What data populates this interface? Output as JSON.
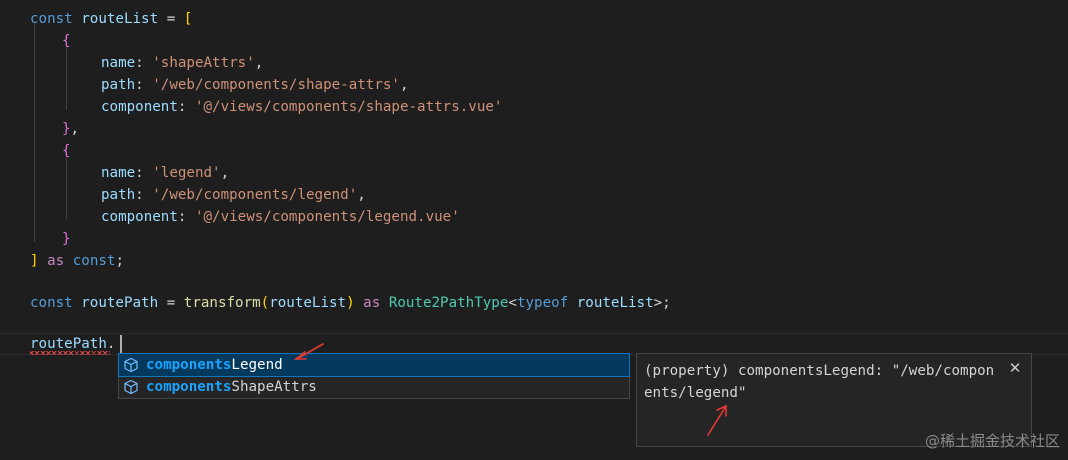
{
  "editor": {
    "lines": {
      "l1": {
        "kw": "const",
        "name": "routeList",
        "eq": "=",
        "open": "["
      },
      "l2": {
        "brace": "{"
      },
      "l3": {
        "key": "name",
        "colon": ":",
        "value": "'shapeAttrs'",
        "comma": ","
      },
      "l4": {
        "key": "path",
        "colon": ":",
        "value": "'/web/components/shape-attrs'",
        "comma": ","
      },
      "l5": {
        "key": "component",
        "colon": ":",
        "value": "'@/views/components/shape-attrs.vue'"
      },
      "l6": {
        "brace": "}",
        "comma": ","
      },
      "l7": {
        "brace": "{"
      },
      "l8": {
        "key": "name",
        "colon": ":",
        "value": "'legend'",
        "comma": ","
      },
      "l9": {
        "key": "path",
        "colon": ":",
        "value": "'/web/components/legend'",
        "comma": ","
      },
      "l10": {
        "key": "component",
        "colon": ":",
        "value": "'@/views/components/legend.vue'"
      },
      "l11": {
        "brace": "}"
      },
      "l12": {
        "close": "]",
        "as": "as",
        "const": "const",
        "semi": ";"
      },
      "l14": {
        "kw": "const",
        "name": "routePath",
        "eq": "=",
        "fn": "transform",
        "paren_open": "(",
        "arg": "routeList",
        "paren_close": ")",
        "as": "as",
        "type": "Route2PathType",
        "lt": "<",
        "typeof": "typeof",
        "typearg": "routeList",
        "gt": ">",
        "semi": ";"
      },
      "l16": {
        "name": "routePath",
        "dot": "."
      }
    }
  },
  "suggest": {
    "items": [
      {
        "match": "components",
        "rest": "Legend",
        "icon": "cube-icon",
        "selected": true
      },
      {
        "match": "components",
        "rest": "ShapeAttrs",
        "icon": "cube-icon",
        "selected": false
      }
    ]
  },
  "details": {
    "text": "(property) componentsLegend: \"/web/components/legend\"",
    "close_label": "✕"
  },
  "watermark": "@稀土掘金技术社区",
  "colors": {
    "background": "#1e1e1e",
    "keyword": "#569cd6",
    "control_keyword": "#c586c0",
    "variable": "#9cdcfe",
    "string": "#ce9178",
    "function": "#dcdcaa",
    "type": "#4ec9b0",
    "selection": "#04395e",
    "match": "#18a3ff",
    "annotation_arrow": "#e53935"
  }
}
